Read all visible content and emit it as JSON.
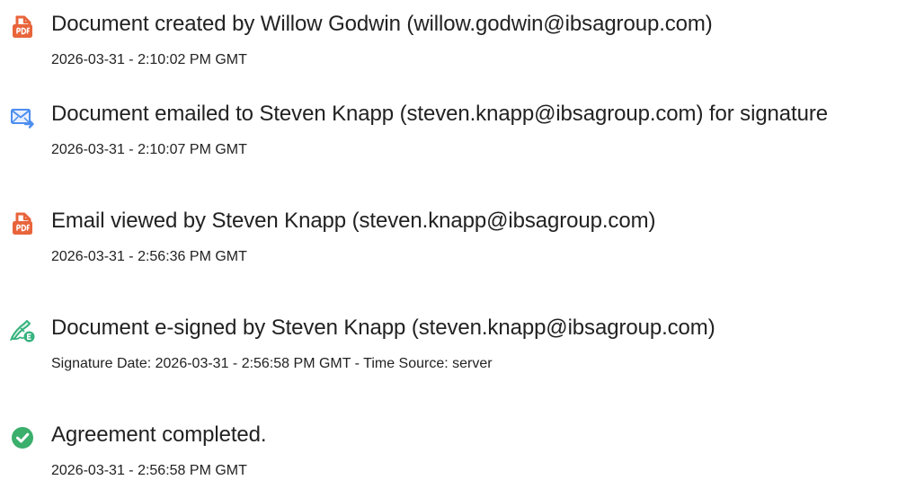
{
  "colors": {
    "doc_icon": "#E8643B",
    "email_icon": "#4D8EF0",
    "sign_icon": "#36B37E",
    "complete_icon": "#3BAF6C",
    "text": "#222222"
  },
  "events": [
    {
      "icon": "document-icon",
      "title": "Document created by Willow Godwin (willow.godwin@ibsagroup.com)",
      "timestamp": "2026-03-31 - 2:10:02 PM GMT"
    },
    {
      "icon": "email-sent-icon",
      "title": "Document emailed to Steven Knapp (steven.knapp@ibsagroup.com) for signature",
      "timestamp": "2026-03-31 - 2:10:07 PM GMT"
    },
    {
      "icon": "document-icon",
      "title": "Email viewed by Steven Knapp (steven.knapp@ibsagroup.com)",
      "timestamp": "2026-03-31 - 2:56:36 PM GMT"
    },
    {
      "icon": "e-sign-pen-icon",
      "title": "Document e-signed by Steven Knapp (steven.knapp@ibsagroup.com)",
      "timestamp": "Signature Date: 2026-03-31 - 2:56:58 PM GMT - Time Source: server"
    },
    {
      "icon": "check-circle-icon",
      "title": "Agreement completed.",
      "timestamp": "2026-03-31 - 2:56:58 PM GMT"
    }
  ]
}
